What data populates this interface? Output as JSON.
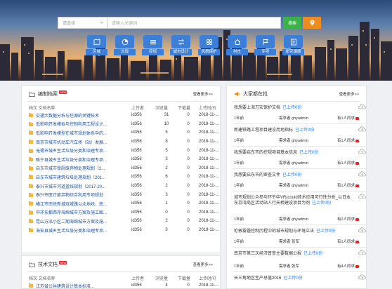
{
  "search": {
    "select_placeholder": "请选择",
    "keyword_placeholder": "请输入关键词",
    "search_label": "搜索"
  },
  "categories": [
    {
      "label": "区域",
      "icon": "map-icon"
    },
    {
      "label": "总规",
      "icon": "pie-chart-icon"
    },
    {
      "label": "控规",
      "icon": "bars-icon"
    },
    {
      "label": "城市设计",
      "icon": "transfer-icon"
    },
    {
      "label": "风貌保护",
      "icon": "grid-icon"
    },
    {
      "label": "村庄",
      "icon": "home-icon"
    },
    {
      "label": "专项",
      "icon": "flag-icon"
    },
    {
      "label": "研究课题",
      "icon": "book-icon"
    }
  ],
  "compiled_docs": {
    "title": "编制档案",
    "badge": "NEW",
    "more": "查看更多>>",
    "headers": [
      "档次 文档名称",
      "上传者",
      "浏览量",
      "下载量",
      "上传时间"
    ],
    "rows": [
      {
        "title": "交通大数据分析与控源的关键技术",
        "uploader": "id356",
        "views": "31",
        "downloads": "0",
        "date": "2018-11-..."
      },
      {
        "title": "低影响开发模拟与控制利用工程设计...",
        "uploader": "id356",
        "views": "10",
        "downloads": "0",
        "date": "2018-11-..."
      },
      {
        "title": "低影响开发模型在城市规划体系中的...",
        "uploader": "id356",
        "views": "5",
        "downloads": "0",
        "date": "2018-11-..."
      },
      {
        "title": "南京市城市机动车汽车场（站）发展...",
        "uploader": "id356",
        "views": "8",
        "downloads": "0",
        "date": "2018-11-..."
      },
      {
        "title": "无锡市城乡生活垃圾分类和治理专项...",
        "uploader": "id356",
        "views": "5",
        "downloads": "0",
        "date": "2018-11-..."
      },
      {
        "title": "睢宁县城乡生活垃圾分类和治理专项...",
        "uploader": "id356",
        "views": "3",
        "downloads": "0",
        "date": "2018-11-..."
      },
      {
        "title": "启东市城市餐厨废弃物处理规划（2...",
        "uploader": "id356",
        "views": "2",
        "downloads": "0",
        "date": "2018-11-..."
      },
      {
        "title": "启东市城市建筑垃圾处理规划（201...",
        "uploader": "id356",
        "views": "6",
        "downloads": "0",
        "date": "2018-11-..."
      },
      {
        "title": "泰兴市城市河道蓝线规划（2017-20...",
        "uploader": "id356",
        "views": "2",
        "downloads": "0",
        "date": "2018-11-..."
      },
      {
        "title": "泰兴市医疗废弃物综合利用专项规划",
        "uploader": "id356",
        "views": "3",
        "downloads": "0",
        "date": "2018-11-..."
      },
      {
        "title": "横江市南徐新城冠城路以北地块、南...",
        "uploader": "id356",
        "views": "1",
        "downloads": "0",
        "date": "2018-11-..."
      },
      {
        "title": "中环东都西岸海绵城市方案及施工图...",
        "uploader": "id356",
        "views": "0",
        "downloads": "0",
        "date": "2018-11-..."
      },
      {
        "title": "昆山万泓小区二期海绵城市方案及施...",
        "uploader": "id356",
        "views": "2",
        "downloads": "0",
        "date": "2018-11-..."
      },
      {
        "title": "海安县城乡生活垃圾分类和治理专项...",
        "uploader": "id356",
        "views": "3",
        "downloads": "0",
        "date": "2018-11-..."
      }
    ]
  },
  "tech_docs": {
    "title": "技术文档",
    "badge": "NEW",
    "more": "查看更多>>",
    "headers": [
      "档次 文档名称",
      "上传者",
      "浏览量",
      "下载量",
      "上传时间"
    ],
    "rows": [
      {
        "title": "江苏省公共建筑设计基本标准...",
        "uploader": "id356",
        "views": "4",
        "downloads": "0",
        "date": "2018-11-..."
      }
    ]
  },
  "looking_for": {
    "title": "大家都在找",
    "more": "查看更多>>",
    "requests": [
      {
        "title": "我想要上海万安保护文档",
        "status": "已上传0份",
        "date": "1年前",
        "requester": "需求者 ghyadmin",
        "same": "有1人同求"
      },
      {
        "title": "新建铁路工程项目建设用地指标",
        "status": "已上传0份",
        "date": "1年前",
        "requester": "需求者 ghyadmin",
        "same": "有1人同求"
      },
      {
        "title": "我想要启东市的控规项目基本信息",
        "status": "已上传0份",
        "date": "1年前",
        "requester": "需求者 ghyadmin",
        "same": "有1人同求"
      },
      {
        "title": "我想要启东市的审查文件",
        "status": "已上传0份",
        "date": "1年前",
        "requester": "需求者 ghyadmin",
        "same": "有1人同求"
      },
      {
        "title": "城市规划公众参与环节中VR(could技术应用可行性分析_以日本东京湾岛区活动站人行天桥建设项目为例",
        "status": "已上传0份",
        "date": "1年前",
        "requester": "需求者 ghyadmin",
        "same": "有2人同求"
      },
      {
        "title": "伦敦雾霾控制历程中的城市规划与环境立法",
        "status": "已上传0份",
        "date": "1年前",
        "requester": "需求者 张军",
        "same": "有1人同求"
      },
      {
        "title": "南京市第三次经济普查主要数据公报",
        "status": "已上传0份",
        "date": "1年前",
        "requester": "需求者 张军",
        "same": "有4人同求"
      },
      {
        "title": "长三角地区生产总值2016",
        "status": "已上传0份",
        "date": "",
        "requester": "",
        "same": ""
      }
    ]
  },
  "colors": {
    "accent_blue": "#3d7fd6",
    "search_green": "#3db24b",
    "location_orange": "#f08c1e",
    "badge_red": "#e0242a",
    "link_blue": "#1a4f99"
  }
}
